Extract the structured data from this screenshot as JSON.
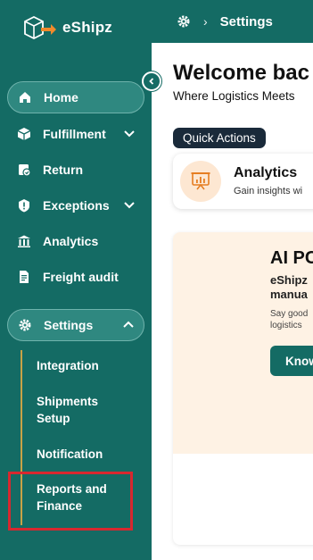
{
  "brand": {
    "name": "eShipz"
  },
  "breadcrumb": {
    "separator": "›",
    "current": "Settings"
  },
  "sidebar": {
    "collapse_icon": "chevron-left-icon",
    "items": [
      {
        "label": "Home",
        "icon": "home-icon",
        "active": true
      },
      {
        "label": "Fulfillment",
        "icon": "box-icon",
        "expandable": true
      },
      {
        "label": "Return",
        "icon": "return-icon"
      },
      {
        "label": "Exceptions",
        "icon": "alert-icon",
        "expandable": true
      },
      {
        "label": "Analytics",
        "icon": "bar-chart-icon"
      },
      {
        "label": "Freight audit",
        "icon": "document-icon"
      },
      {
        "label": "Settings",
        "icon": "gear-icon",
        "expanded": true
      }
    ],
    "settings_sub": [
      {
        "label": "Integration"
      },
      {
        "label": "Shipments Setup",
        "line1": "Shipments",
        "line2": "Setup"
      },
      {
        "label": "Notification"
      },
      {
        "label": "Reports and Finance",
        "line1": "Reports and",
        "line2": "Finance"
      }
    ]
  },
  "main": {
    "welcome": "Welcome bac",
    "tagline": "Where Logistics Meets",
    "quick_actions_label": "Quick Actions",
    "analytics_card": {
      "title": "Analytics",
      "subtitle": "Gain insights wi"
    },
    "promo": {
      "title": "AI PC",
      "subtitle_line1": "eShipz",
      "subtitle_line2": "manua",
      "desc_line1": "Say good",
      "desc_line2": "logistics",
      "button_label": "Know"
    }
  },
  "colors": {
    "primary": "#146b64",
    "accent_highlight": "#d7282f",
    "sub_line": "#c9a246",
    "badge_bg": "#1a2a3a"
  }
}
